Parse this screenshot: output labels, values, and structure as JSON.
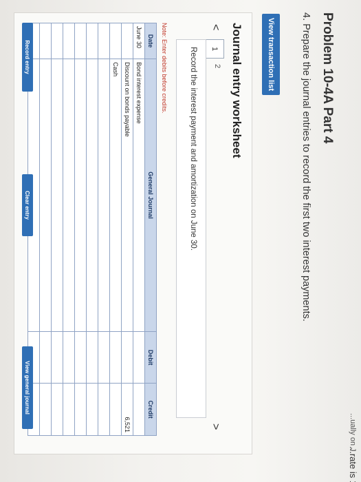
{
  "header": {
    "corner_line1": "...rate is 12%.",
    "corner_line2": "...ually on J",
    "title": "Problem 10-4A Part 4",
    "instruction": "4. Prepare the journal entries to record the first two interest payments."
  },
  "buttons": {
    "view_transaction_list": "View transaction list",
    "record_entry": "Record entry",
    "clear_entry": "Clear entry",
    "view_general_journal": "View general journal"
  },
  "worksheet": {
    "title": "Journal entry worksheet",
    "prev": "<",
    "next": ">",
    "tabs": [
      "1",
      "2"
    ],
    "record_text": "Record the interest payment and amortization on June 30.",
    "note": "Note: Enter debits before credits."
  },
  "journal": {
    "columns": [
      "Date",
      "General Journal",
      "Debit",
      "Credit"
    ],
    "rows": [
      {
        "date": "June 30",
        "account": "Bond interest expense",
        "debit": "",
        "credit": ""
      },
      {
        "date": "",
        "account": "Discount on bonds payable",
        "debit": "",
        "credit": "6,521"
      },
      {
        "date": "",
        "account": "Cash",
        "debit": "",
        "credit": ""
      },
      {
        "date": "",
        "account": "",
        "debit": "",
        "credit": ""
      },
      {
        "date": "",
        "account": "",
        "debit": "",
        "credit": ""
      },
      {
        "date": "",
        "account": "",
        "debit": "",
        "credit": ""
      },
      {
        "date": "",
        "account": "",
        "debit": "",
        "credit": ""
      },
      {
        "date": "",
        "account": "",
        "debit": "",
        "credit": ""
      },
      {
        "date": "",
        "account": "",
        "debit": "",
        "credit": ""
      },
      {
        "date": "",
        "account": "",
        "debit": "",
        "credit": ""
      }
    ]
  },
  "colors": {
    "button_blue": "#2f6fb5",
    "table_header": "#c9d6ea",
    "note_red": "#c0392b"
  }
}
